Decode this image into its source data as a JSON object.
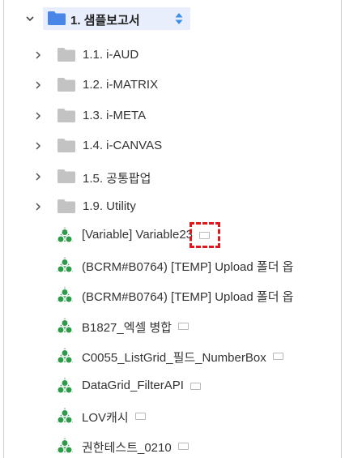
{
  "root": {
    "label": "1. 샘플보고서"
  },
  "folders": [
    {
      "label": "1.1. i-AUD"
    },
    {
      "label": "1.2. i-MATRIX"
    },
    {
      "label": "1.3. i-META"
    },
    {
      "label": "1.4. i-CANVAS"
    },
    {
      "label": "1.5. 공통팝업"
    },
    {
      "label": "1.9. Utility"
    }
  ],
  "reports": [
    {
      "label": "[Variable] Variable23",
      "icon": "report-app-icon",
      "has_view_icon": true,
      "selected_view_icon": true
    },
    {
      "label": "(BCRM#B0764) [TEMP] Upload 폴더 옵",
      "icon": "report-app-icon",
      "has_view_icon": false
    },
    {
      "label": "(BCRM#B0764) [TEMP] Upload 폴더 옵",
      "icon": "report-app-icon",
      "has_view_icon": false
    },
    {
      "label": "B1827_엑셀 병합",
      "icon": "report-app-icon",
      "has_view_icon": true
    },
    {
      "label": "C0055_ListGrid_필드_NumberBox",
      "icon": "report-app-icon",
      "has_view_icon": true
    },
    {
      "label": "DataGrid_FilterAPI",
      "icon": "report-app-icon",
      "has_view_icon": true
    },
    {
      "label": "LOV캐시",
      "icon": "report-app-icon",
      "has_view_icon": true
    },
    {
      "label": "권한테스트_0210",
      "icon": "report-app-icon",
      "has_view_icon": true
    }
  ],
  "colors": {
    "root_folder": "#4a86e8",
    "folder": "#c3c3c3",
    "report_icon": "#2e9b4b",
    "highlight": "#e8eefb",
    "selection_marker": "#e0161c"
  }
}
